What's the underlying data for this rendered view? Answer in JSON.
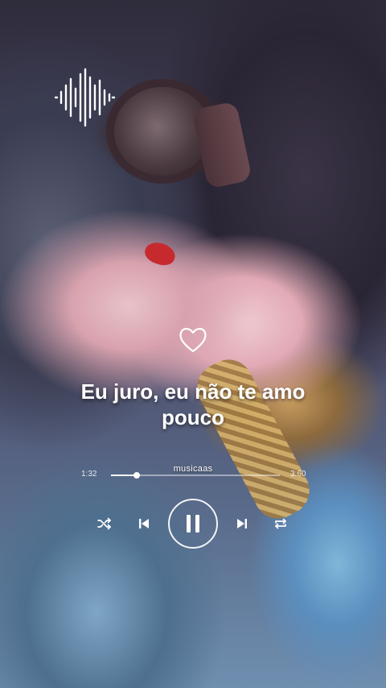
{
  "lyrics": {
    "line1": "Eu juro, eu não te amo",
    "line2": "pouco"
  },
  "player": {
    "track_name": "musicaas",
    "elapsed": "1:32",
    "total": "3:60",
    "progress": 0.15
  },
  "icons": {
    "soundwave": "soundwave-icon",
    "heart": "heart-outline-icon",
    "shuffle": "shuffle-icon",
    "previous": "skip-previous-icon",
    "pause": "pause-icon",
    "next": "skip-next-icon",
    "repeat": "repeat-icon"
  },
  "colors": {
    "text": "#ffffff",
    "nail": "#c72a2e"
  }
}
